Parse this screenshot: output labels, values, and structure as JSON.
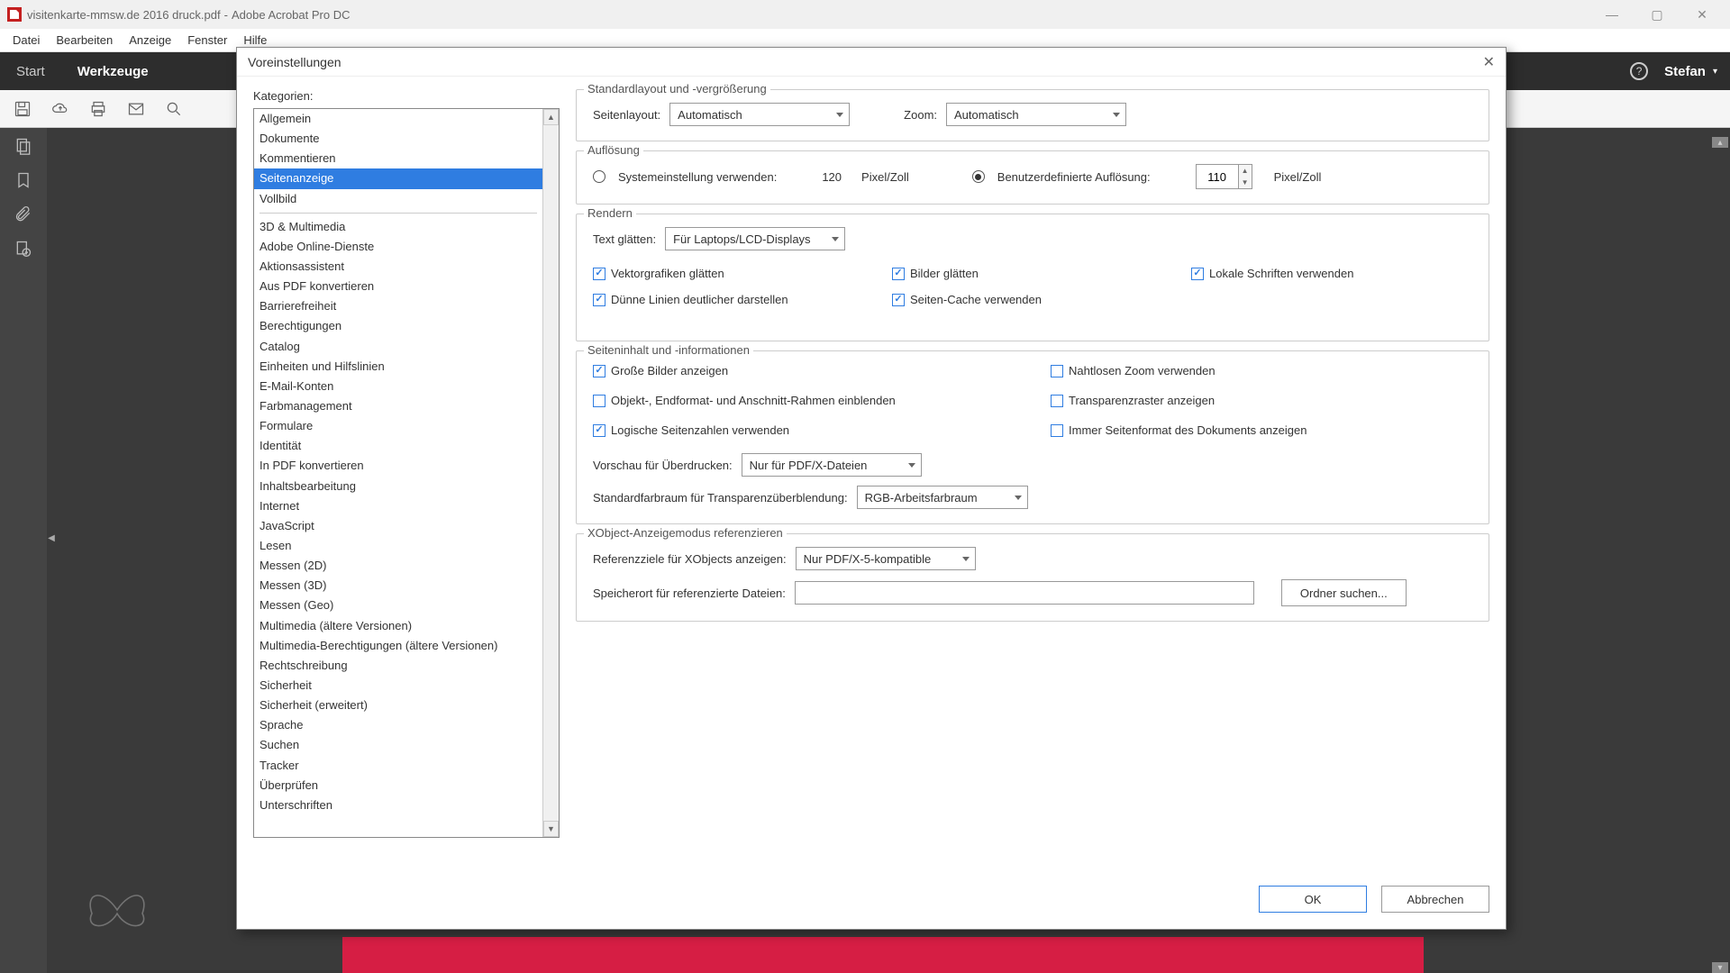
{
  "titlebar": {
    "doc": "visitenkarte-mmsw.de 2016 druck.pdf",
    "app": "Adobe Acrobat Pro DC"
  },
  "window_controls": {
    "min": "—",
    "max": "▢",
    "close": "✕"
  },
  "menubar": [
    "Datei",
    "Bearbeiten",
    "Anzeige",
    "Fenster",
    "Hilfe"
  ],
  "tabs": {
    "start": "Start",
    "werkzeuge": "Werkzeuge"
  },
  "user": "Stefan",
  "dialog": {
    "title": "Voreinstellungen",
    "categories_label": "Kategorien:",
    "categories_top": [
      "Allgemein",
      "Dokumente",
      "Kommentieren",
      "Seitenanzeige",
      "Vollbild"
    ],
    "selected_category": "Seitenanzeige",
    "categories_rest": [
      "3D & Multimedia",
      "Adobe Online-Dienste",
      "Aktionsassistent",
      "Aus PDF konvertieren",
      "Barrierefreiheit",
      "Berechtigungen",
      "Catalog",
      "Einheiten und Hilfslinien",
      "E-Mail-Konten",
      "Farbmanagement",
      "Formulare",
      "Identität",
      "In PDF konvertieren",
      "Inhaltsbearbeitung",
      "Internet",
      "JavaScript",
      "Lesen",
      "Messen (2D)",
      "Messen (3D)",
      "Messen (Geo)",
      "Multimedia (ältere Versionen)",
      "Multimedia-Berechtigungen (ältere Versionen)",
      "Rechtschreibung",
      "Sicherheit",
      "Sicherheit (erweitert)",
      "Sprache",
      "Suchen",
      "Tracker",
      "Überprüfen",
      "Unterschriften"
    ],
    "sec_layout": {
      "legend": "Standardlayout und -vergrößerung",
      "pagelayout_label": "Seitenlayout:",
      "pagelayout_value": "Automatisch",
      "zoom_label": "Zoom:",
      "zoom_value": "Automatisch"
    },
    "sec_res": {
      "legend": "Auflösung",
      "sys_label": "Systemeinstellung verwenden:",
      "sys_value": "120",
      "unit": "Pixel/Zoll",
      "custom_label": "Benutzerdefinierte Auflösung:",
      "custom_value": "110"
    },
    "sec_render": {
      "legend": "Rendern",
      "textsmooth_label": "Text glätten:",
      "textsmooth_value": "Für Laptops/LCD-Displays",
      "cb_vector": "Vektorgrafiken glätten",
      "cb_images": "Bilder glätten",
      "cb_fonts": "Lokale Schriften verwenden",
      "cb_thinlines": "Dünne Linien deutlicher darstellen",
      "cb_cache": "Seiten-Cache verwenden"
    },
    "sec_content": {
      "legend": "Seiteninhalt und -informationen",
      "cb_largeimg": "Große Bilder anzeigen",
      "cb_seamless": "Nahtlosen Zoom verwenden",
      "cb_boxes": "Objekt-, Endformat- und Anschnitt-Rahmen einblenden",
      "cb_transparency": "Transparenzraster anzeigen",
      "cb_logical": "Logische Seitenzahlen verwenden",
      "cb_pagesize": "Immer Seitenformat des Dokuments anzeigen",
      "overprint_label": "Vorschau für Überdrucken:",
      "overprint_value": "Nur für PDF/X-Dateien",
      "blend_label": "Standardfarbraum für Transparenzüberblendung:",
      "blend_value": "RGB-Arbeitsfarbraum"
    },
    "sec_xobj": {
      "legend": "XObject-Anzeigemodus referenzieren",
      "targets_label": "Referenzziele für XObjects anzeigen:",
      "targets_value": "Nur PDF/X-5-kompatible",
      "location_label": "Speicherort für referenzierte Dateien:",
      "browse_btn": "Ordner suchen..."
    },
    "ok": "OK",
    "cancel": "Abbrechen"
  }
}
